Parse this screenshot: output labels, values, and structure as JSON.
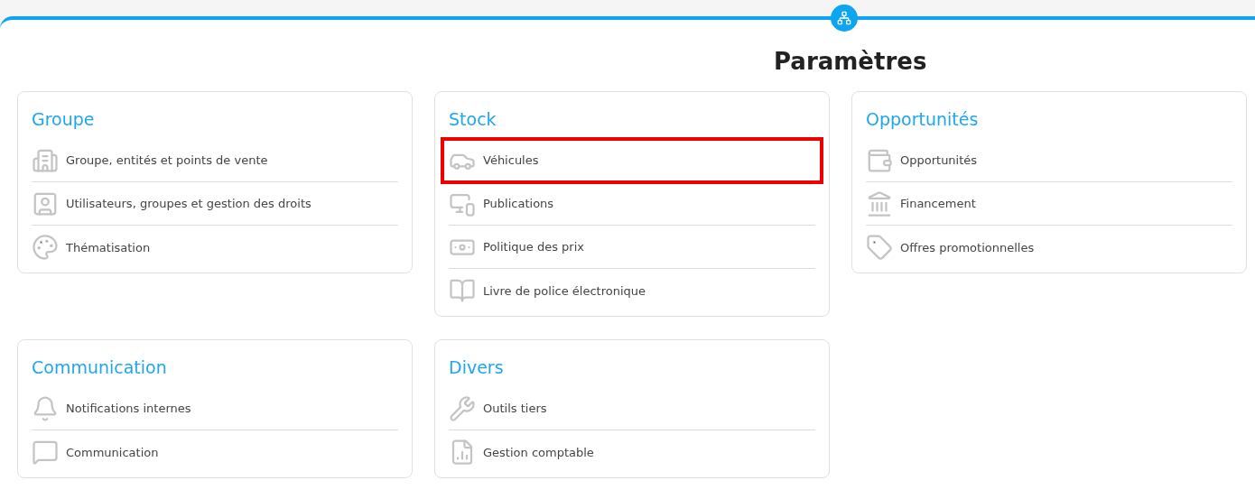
{
  "title": "Paramètres",
  "sections": [
    {
      "title": "Groupe",
      "items": [
        {
          "label": "Groupe, entités et points de vente",
          "highlighted": false
        },
        {
          "label": "Utilisateurs, groupes et gestion des droits",
          "highlighted": false
        },
        {
          "label": "Thématisation",
          "highlighted": false
        }
      ]
    },
    {
      "title": "Stock",
      "items": [
        {
          "label": "Véhicules",
          "highlighted": true
        },
        {
          "label": "Publications",
          "highlighted": false
        },
        {
          "label": "Politique des prix",
          "highlighted": false
        },
        {
          "label": "Livre de police électronique",
          "highlighted": false
        }
      ]
    },
    {
      "title": "Opportunités",
      "items": [
        {
          "label": "Opportunités",
          "highlighted": false
        },
        {
          "label": "Financement",
          "highlighted": false
        },
        {
          "label": "Offres promotionnelles",
          "highlighted": false
        }
      ]
    },
    {
      "title": "Communication",
      "items": [
        {
          "label": "Notifications internes",
          "highlighted": false
        },
        {
          "label": "Communication",
          "highlighted": false
        }
      ]
    },
    {
      "title": "Divers",
      "items": [
        {
          "label": "Outils tiers",
          "highlighted": false
        },
        {
          "label": "Gestion comptable",
          "highlighted": false
        }
      ]
    }
  ]
}
